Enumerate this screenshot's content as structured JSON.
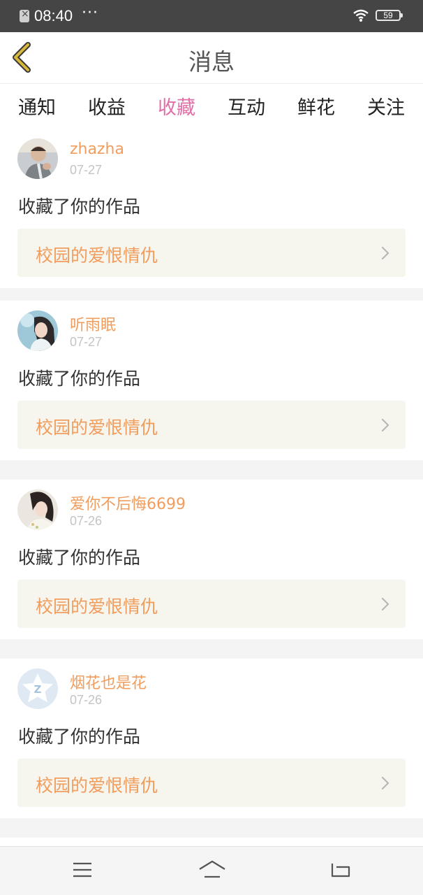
{
  "status_bar": {
    "time": "08:40",
    "dots": "···",
    "battery": "59"
  },
  "header": {
    "title": "消息"
  },
  "tabs": [
    {
      "label": "通知",
      "active": false
    },
    {
      "label": "收益",
      "active": false
    },
    {
      "label": "收藏",
      "active": true
    },
    {
      "label": "互动",
      "active": false
    },
    {
      "label": "鲜花",
      "active": false
    },
    {
      "label": "关注",
      "active": false
    }
  ],
  "messages": [
    {
      "username": "zhazha",
      "date": "07-27",
      "action": "收藏了你的作品",
      "work_title": "校园的爱恨情仇",
      "avatar": "person-photo-avatar"
    },
    {
      "username": "听雨眠",
      "date": "07-27",
      "action": "收藏了你的作品",
      "work_title": "校园的爱恨情仇",
      "avatar": "girl-photo-avatar"
    },
    {
      "username": "爱你不后悔6699",
      "date": "07-26",
      "action": "收藏了你的作品",
      "work_title": "校园的爱恨情仇",
      "avatar": "girl-photo-avatar"
    },
    {
      "username": "烟花也是花",
      "date": "07-26",
      "action": "收藏了你的作品",
      "work_title": "校园的爱恨情仇",
      "avatar": "default-star-avatar"
    }
  ],
  "colors": {
    "accent_pink": "#e06fa6",
    "orange_text": "#f19d5e",
    "back_arrow": "#d9b93a"
  },
  "icons": {
    "back": "chevron-left-icon",
    "menu": "menu-icon",
    "home": "home-icon",
    "return": "return-icon",
    "wifi": "wifi-icon",
    "chevron": "chevron-right-icon"
  }
}
